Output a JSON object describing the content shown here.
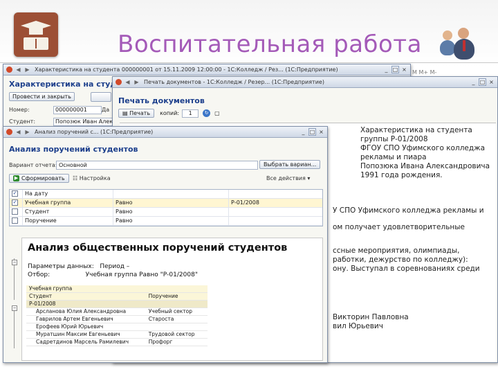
{
  "slide": {
    "title": "Воспитательная работа",
    "colors": {
      "title": "#a45ab8",
      "logo": "#9c4f35",
      "form_title": "#1c3f8c"
    },
    "logo_icon": "graduation-cap-book-icon",
    "people_icon": "people-icon"
  },
  "window_student": {
    "title": "Характеристика на студента 000000001 от 15.11.2009 12:00:00 - 1С:Колледж / Рез... (1С:Предприятие)",
    "form_title": "Характеристика на студ",
    "btn_post_close": "Провести и закрыть",
    "btn_save": "",
    "number_label": "Номер:",
    "number_value": "000000001",
    "date_label": "Да",
    "student_label": "Студент:",
    "student_value": "Попозюк Иван Александрович",
    "mm": "M  M+  M-"
  },
  "window_print": {
    "title": "Печать документов - 1С:Колледж / Резер... (1С:Предприятие)",
    "form_title": "Печать документов",
    "print_button": "Печать",
    "copies_label": "копий:",
    "copies_value": "1",
    "mm": "M  M+  M-",
    "doc_lines_right": [
      "Характеристика на студента",
      "группы Р-01/2008",
      "ФГОУ СПО Уфимского колледжа",
      "рекламы и пиара",
      "Попозюка Ивана Александровича",
      "1991 года рождения."
    ],
    "doc_lines_body": [
      "У СПО Уфимского колледжа рекламы и",
      "ом получает удовлетворительные",
      "ссные мероприятия, олимпиады,",
      "работки, дежурство по колледжу):",
      "ону. Выступал в соревнованиях среди",
      "Викторин Павловна",
      "вил Юрьевич"
    ]
  },
  "window_analysis": {
    "title": "Анализ поручений с... (1С:Предприятие)",
    "form_title": "Анализ поручений студентов",
    "variant_label": "Вариант отчета:",
    "variant_value": "Основной",
    "choose_variant_button": "Выбрать вариан...",
    "generate_button": "Сформировать",
    "settings_button": "Настройка",
    "all_actions": "Все действия ▾",
    "filters": [
      {
        "checked": true,
        "name": "На дату",
        "cond": "",
        "value": ""
      },
      {
        "checked": true,
        "name": "Учебная группа",
        "cond": "Равно",
        "value": "Р-01/2008"
      },
      {
        "checked": false,
        "name": "Студент",
        "cond": "Равно",
        "value": ""
      },
      {
        "checked": false,
        "name": "Поручение",
        "cond": "Равно",
        "value": ""
      }
    ],
    "report": {
      "title": "Анализ общественных поручений студентов",
      "params_label": "Параметры данных:",
      "params_value": "Период –",
      "filter_label": "Отбор:",
      "filter_value": "Учебная группа Равно \"Р-01/2008\"",
      "group_header": "Учебная группа",
      "col_student": "Студент",
      "col_assignment": "Поручение",
      "group_name": "Р-01/2008",
      "rows": [
        {
          "student": "Арсланова Юлия Александровна",
          "assignment": "Учебный сектор"
        },
        {
          "student": "Гаврилов Артем Евгеньевич",
          "assignment": "Староста"
        },
        {
          "student": "Ерофеев Юрий Юрьевич",
          "assignment": ""
        },
        {
          "student": "Муратшин Максим Евгеньевич",
          "assignment": "Трудовой сектор"
        },
        {
          "student": "Садретдинов Марсель Рамилевич",
          "assignment": "Профорг"
        }
      ]
    }
  }
}
